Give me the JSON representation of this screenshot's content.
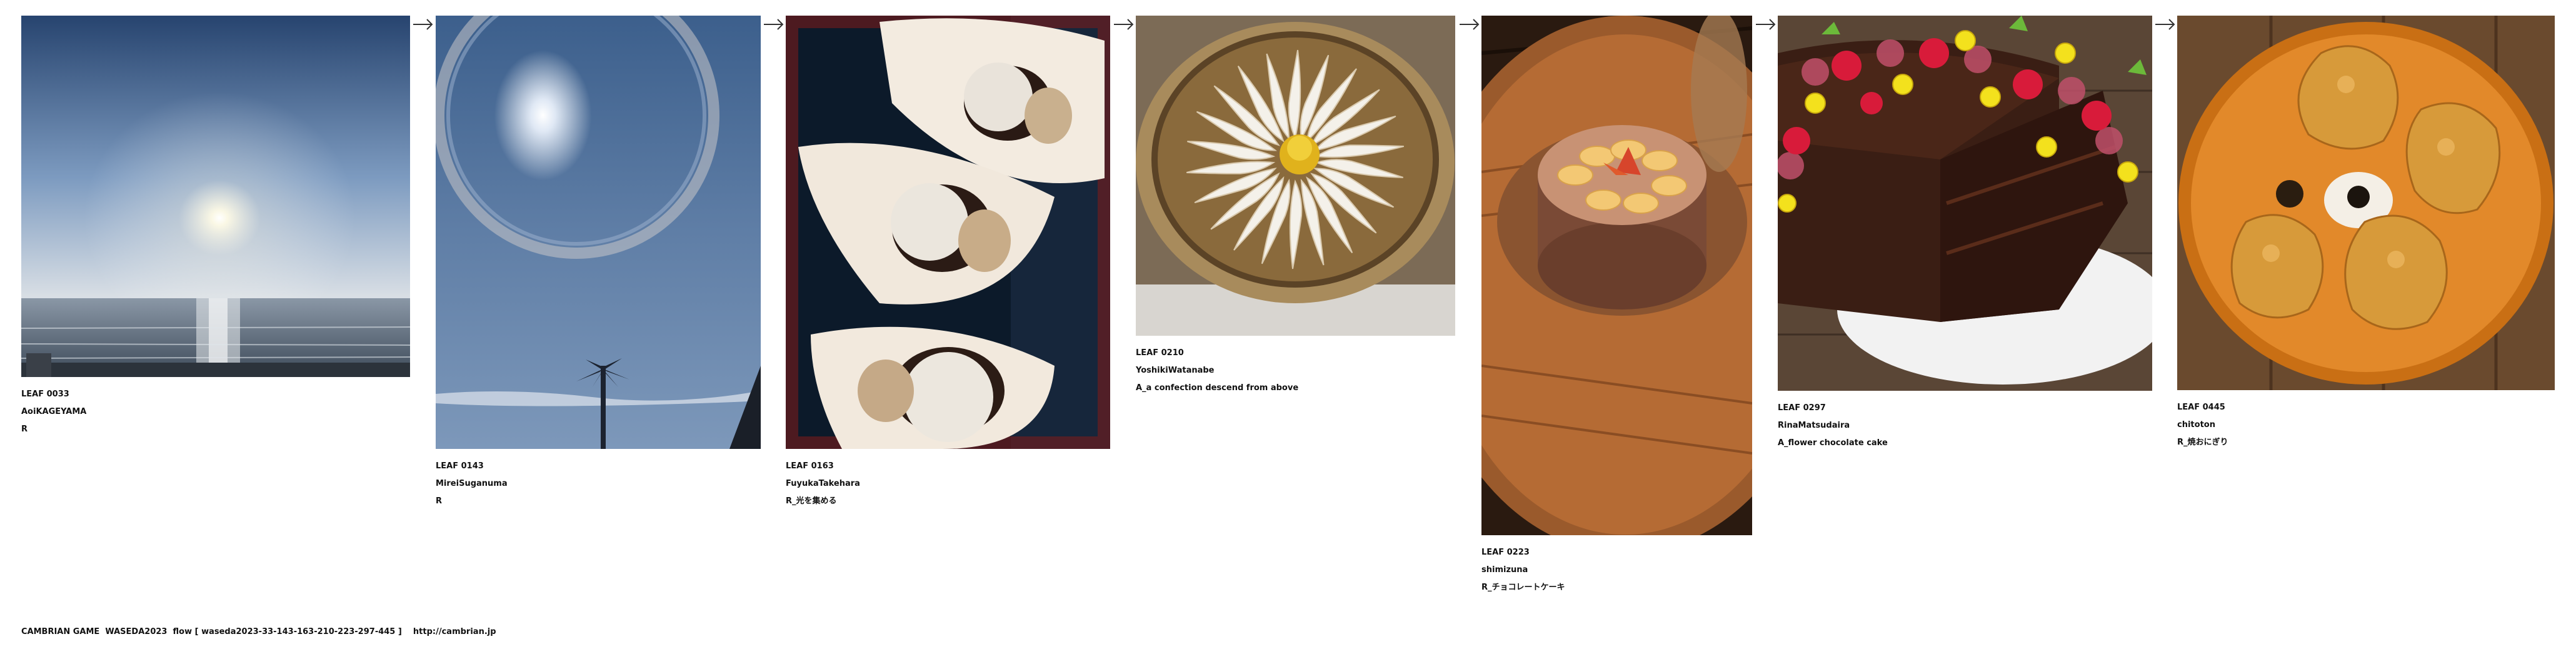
{
  "leaves": [
    {
      "id": "LEAF 0033",
      "author": "AoiKAGEYAMA",
      "note": "R",
      "subject": "sunrise over the sea"
    },
    {
      "id": "LEAF 0143",
      "author": "MireiSuganuma",
      "note": "R",
      "subject": "sun halo with palm tree"
    },
    {
      "id": "LEAF 0163",
      "author": "FuyukaTakehara",
      "note": "R_光を集める",
      "subject": "desserts on wooden boats"
    },
    {
      "id": "LEAF 0210",
      "author": "YoshikiWatanabe",
      "note": "A_a confection descend from above",
      "subject": "radial cream confection"
    },
    {
      "id": "LEAF 0223",
      "author": "shimizuna",
      "note": "R_チョコレートケーキ",
      "subject": "fruit-topped cake on wooden table"
    },
    {
      "id": "LEAF 0297",
      "author": "RinaMatsudaira",
      "note": "A_flower chocolate cake",
      "subject": "chocolate cake with flowers and strawberries"
    },
    {
      "id": "LEAF 0445",
      "author": "chitoton",
      "note": "R_焼おにぎり",
      "subject": "grilled rice balls on orange plate"
    }
  ],
  "arrow_icon": "right-arrow-icon",
  "footer": {
    "text": "CAMBRIAN GAME  WASEDA2023  flow [ waseda2023-33-143-163-210-223-297-445 ]    http://cambrian.jp"
  }
}
